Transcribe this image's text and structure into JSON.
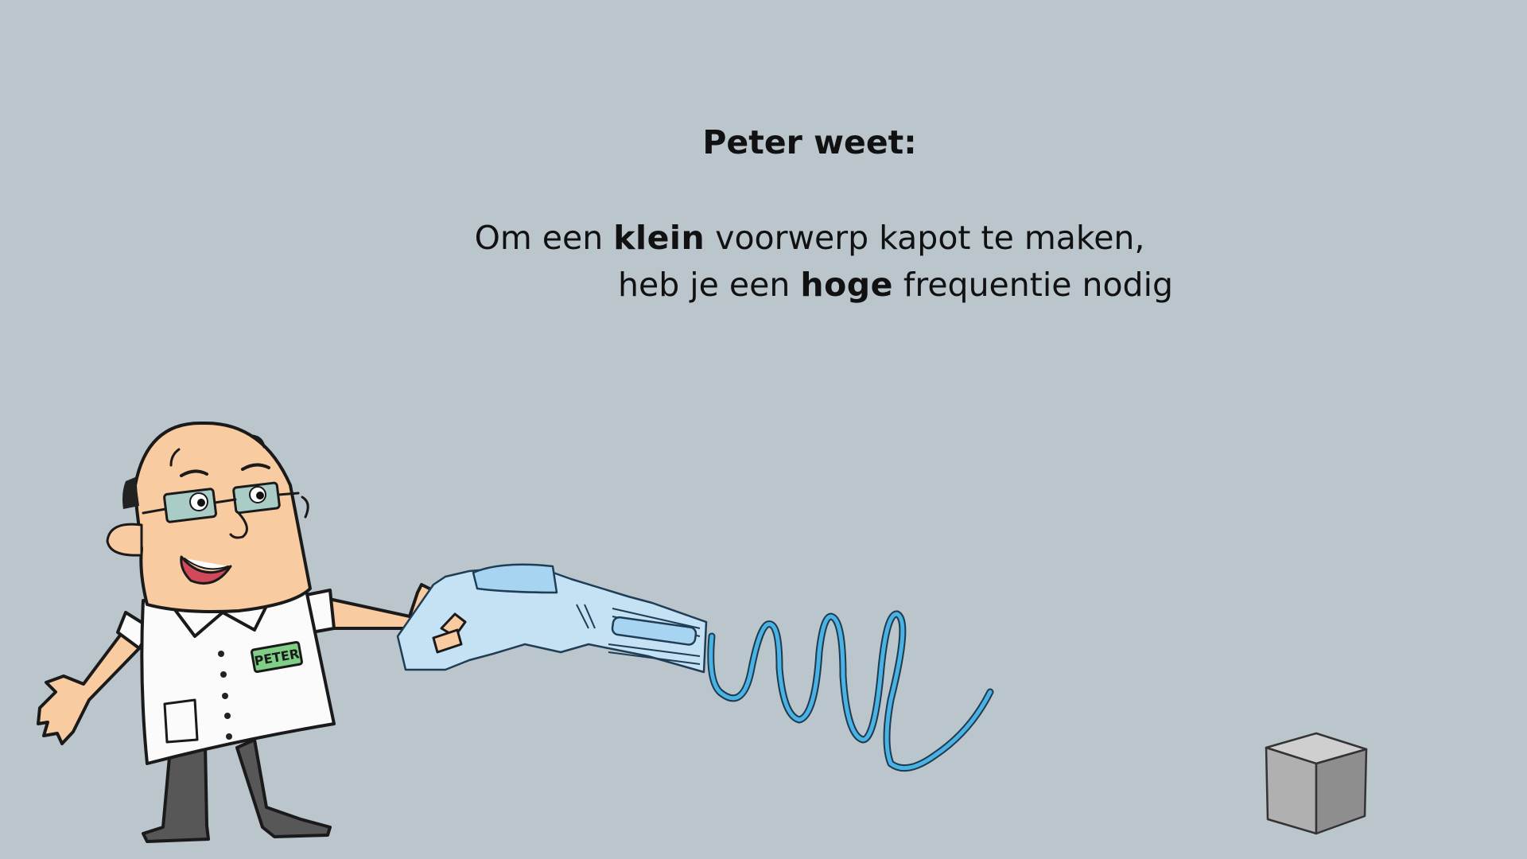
{
  "slide": {
    "title": "Peter weet:",
    "fact": {
      "line1_before": "Om een ",
      "line1_bold": "klein",
      "line1_after": " voorwerp kapot te maken,",
      "line2_before": "heb je een ",
      "line2_bold": "hoge",
      "line2_after": " frequentie nodig"
    }
  },
  "character": {
    "badge_text": "PETER"
  },
  "colors": {
    "background": "#bac5cc",
    "skin": "#f9cba1",
    "coat": "#fbfbfb",
    "badge": "#7fcf86",
    "gun": "#c4e2f4",
    "wave": "#4ab3e6",
    "cube": "#a9a9a9"
  },
  "icons": {
    "cube": "cube-icon",
    "wave": "sound-wave",
    "gun": "frequency-gun"
  }
}
